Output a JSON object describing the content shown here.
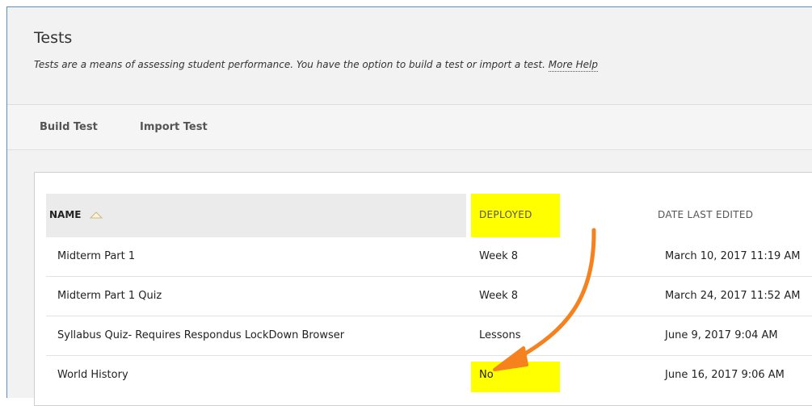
{
  "page": {
    "title": "Tests",
    "description": "Tests are a means of assessing student performance. You have the option to build a test or import a test.",
    "help_link": "More Help"
  },
  "actions": {
    "build_test": "Build Test",
    "import_test": "Import Test"
  },
  "table": {
    "columns": {
      "name": "NAME",
      "deployed": "DEPLOYED",
      "date_last_edited": "DATE LAST EDITED"
    },
    "sort": {
      "column": "name",
      "direction": "ascending"
    },
    "rows": [
      {
        "name": "Midterm Part 1",
        "deployed": "Week 8",
        "date": "March 10, 2017 11:19 AM"
      },
      {
        "name": "Midterm Part 1 Quiz",
        "deployed": "Week 8",
        "date": "March 24, 2017 11:52 AM"
      },
      {
        "name": "Syllabus Quiz- Requires Respondus LockDown Browser",
        "deployed": "Lessons",
        "date": "June 9, 2017 9:04 AM"
      },
      {
        "name": "World History",
        "deployed": "No",
        "date": "June 16, 2017 9:06 AM"
      }
    ]
  },
  "annotation": {
    "highlight_color": "#ffff00",
    "arrow_color": "#f5821f",
    "arrow_icon": "curved-arrow-icon"
  }
}
